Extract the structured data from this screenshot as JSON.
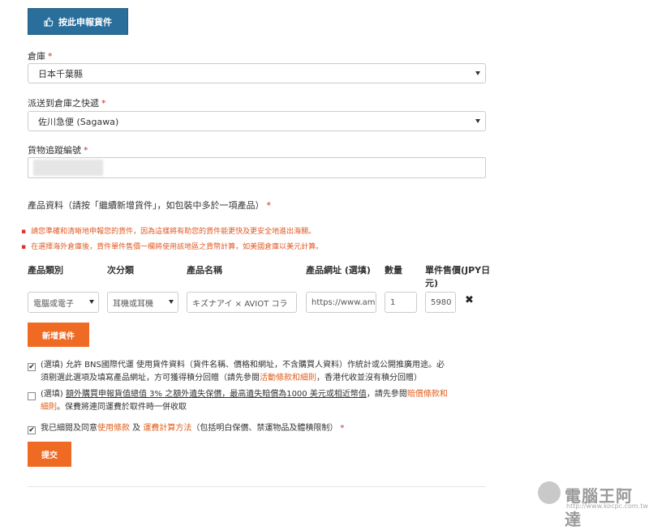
{
  "header": {
    "declare_button": "按此申報貨件"
  },
  "warehouse": {
    "label": "倉庫",
    "required": "*",
    "value": "日本千葉縣"
  },
  "courier": {
    "label": "派送到倉庫之快遞",
    "required": "*",
    "value": "佐川急便 (Sagawa)"
  },
  "tracking": {
    "label": "貨物追蹤編號",
    "required": "*"
  },
  "products": {
    "label": "產品資料（請按「繼續新增貨件」，如包裝中多於一項產品）",
    "required": "*",
    "notices": [
      "請您準確和清晰地申報您的貨件，因為這樣將有助您的貨件能更快及更安全地進出海關。",
      "在選擇海外倉庫後，貨件單件售價一欄將使用該地區之貨幣計算，如美國倉庫以美元計算。"
    ],
    "columns": [
      "產品類別",
      "次分類",
      "產品名稱",
      "產品網址 (選填)",
      "數量",
      "單件售價(JPY日",
      "元)"
    ],
    "row": {
      "category": "電腦或電子",
      "subcategory": "耳機或耳機",
      "name": "キズナアイ × AVIOT コラ",
      "url": "https://www.ama",
      "qty": "1",
      "price": "5980",
      "remove": "✖"
    },
    "add_button": "新增貨件"
  },
  "consents": {
    "c1_a": "(選填) 允許 BNS國際代運 使用貨件資料（貨件名稱、價格和網址，不含購買人資料）作統計或公開推廣用途。必",
    "c1_b": "須剔選此選項及填寫產品網址，方可獲得積分回贈（請先參閱",
    "c1_link": "活動條款和細則",
    "c1_c": "，香港代收並沒有積分回贈）",
    "c2_a": "(選填) ",
    "c2_under": "額外購買申報貨值總值 3% 之額外遺失保價，最高遺失賠償為1000 美元或相近幣值",
    "c2_b": "，請先參閱",
    "c2_link": "賠償條款和",
    "c2_link2": "細則",
    "c2_c": "。保費將連同運費於取件時一併收取",
    "c3_a": "我已細閱及同意",
    "c3_link1": "使用條款",
    "c3_and": " 及 ",
    "c3_link2": "運費計算方法",
    "c3_b": "（包括明白保價、禁運物品及體積限制）",
    "c3_req": "*",
    "c1_checked": "✔",
    "c3_checked": "✔"
  },
  "submit": "提交",
  "watermark": {
    "name": "電腦王阿達",
    "url": "http://www.kocpc.com.tw"
  }
}
